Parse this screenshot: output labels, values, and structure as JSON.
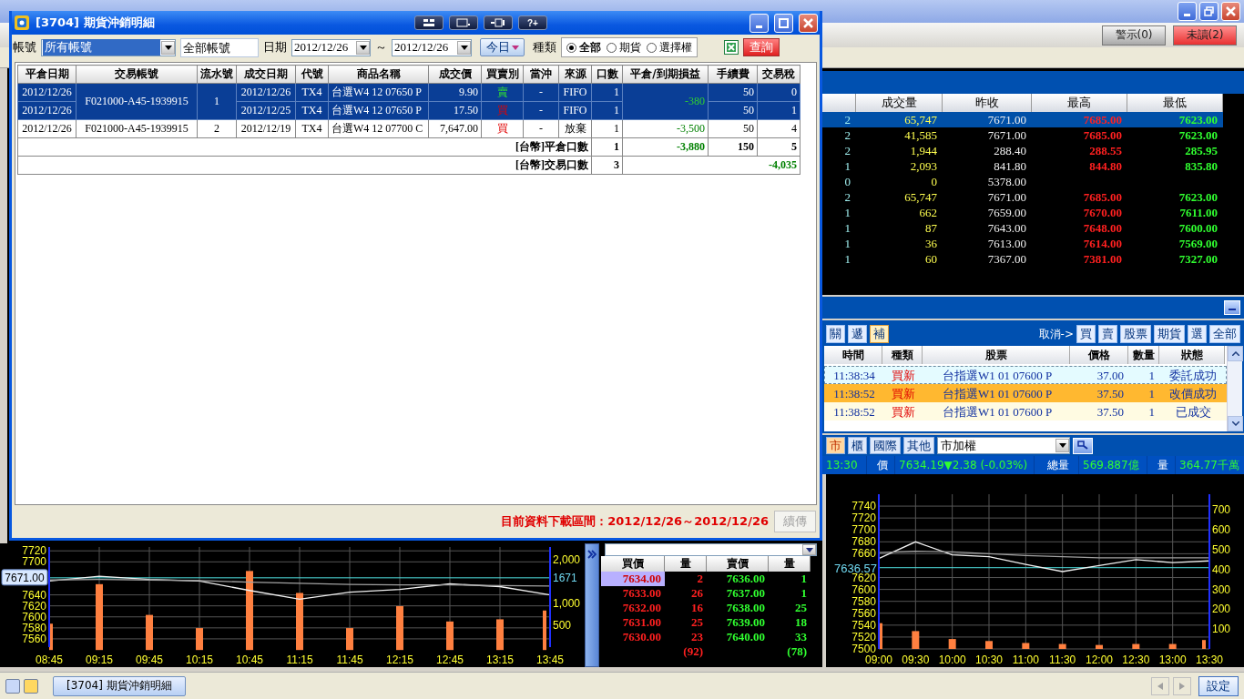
{
  "top_bar": {
    "alerts": [
      {
        "label": "警示(0)",
        "kind": "plain"
      },
      {
        "label": "未讀(2)",
        "kind": "alert"
      }
    ]
  },
  "quotes": {
    "columns": [
      "成交量",
      "昨收",
      "最高",
      "最低"
    ],
    "rows": [
      {
        "selected": true,
        "count": "2",
        "volume": "65,747",
        "prev_close": "7671.00",
        "high": "7685.00",
        "low": "7623.00"
      },
      {
        "selected": false,
        "count": "2",
        "volume": "41,585",
        "prev_close": "7671.00",
        "high": "7685.00",
        "low": "7623.00"
      },
      {
        "selected": false,
        "count": "2",
        "volume": "1,944",
        "prev_close": "288.40",
        "high": "288.55",
        "low": "285.95"
      },
      {
        "selected": false,
        "count": "1",
        "volume": "2,093",
        "prev_close": "841.80",
        "high": "844.80",
        "low": "835.80"
      },
      {
        "selected": false,
        "count": "0",
        "volume": "0",
        "prev_close": "5378.00"
      },
      {
        "selected": false,
        "count": "2",
        "volume": "65,747",
        "prev_close": "7671.00",
        "high": "7685.00",
        "low": "7623.00"
      },
      {
        "selected": false,
        "count": "1",
        "volume": "662",
        "prev_close": "7659.00",
        "high": "7670.00",
        "low": "7611.00"
      },
      {
        "selected": false,
        "count": "1",
        "volume": "87",
        "prev_close": "7643.00",
        "high": "7648.00",
        "low": "7600.00"
      },
      {
        "selected": false,
        "count": "1",
        "volume": "36",
        "prev_close": "7613.00",
        "high": "7614.00",
        "low": "7569.00"
      },
      {
        "selected": false,
        "count": "1",
        "volume": "60",
        "prev_close": "7367.00",
        "high": "7381.00",
        "low": "7327.00"
      }
    ]
  },
  "orders": {
    "actions": [
      {
        "label": "關",
        "selected": false
      },
      {
        "label": "遞",
        "selected": false
      },
      {
        "label": "補",
        "selected": true
      }
    ],
    "cancel_label": "取消->",
    "cancel_buttons": [
      "買",
      "賣",
      "股票",
      "期貨",
      "選",
      "全部"
    ],
    "columns": [
      "時間",
      "種類",
      "股票",
      "價格",
      "數量",
      "狀態"
    ],
    "rows": [
      {
        "selected": false,
        "focused": true,
        "time": "11:38:34",
        "type": "買新",
        "symbol": "台指選W1 01 07600 P",
        "price": "37.00",
        "qty": "1",
        "status": "委託成功"
      },
      {
        "selected": true,
        "focused": false,
        "time": "11:38:52",
        "type": "買新",
        "symbol": "台指選W1 01 07600 P",
        "price": "37.50",
        "qty": "1",
        "status": "改價成功"
      },
      {
        "selected": false,
        "focused": false,
        "time": "11:38:52",
        "type": "買新",
        "symbol": "台指選W1 01 07600 P",
        "price": "37.50",
        "qty": "1",
        "status": "已成交"
      }
    ]
  },
  "market": {
    "tabs": [
      {
        "label": "市",
        "selected": true
      },
      {
        "label": "櫃",
        "selected": false
      },
      {
        "label": "國際",
        "selected": false
      },
      {
        "label": "其他",
        "selected": false
      }
    ],
    "index_select": "市加權",
    "info": {
      "time": "13:30",
      "price_label": "價",
      "price": "7634.19▼2.38 (-0.03%)",
      "volume_label": "總量",
      "volume": "569.887億",
      "qty_label": "量",
      "qty": "364.77千萬"
    },
    "chart_data": {
      "type": "line",
      "categories": [
        "09:00",
        "09:30",
        "10:00",
        "10:30",
        "11:00",
        "11:30",
        "12:00",
        "12:30",
        "13:00",
        "13:30"
      ],
      "ylim": [
        7500,
        7760
      ],
      "yticks": [
        7500,
        7520,
        7540,
        7560,
        7580,
        7600,
        7620,
        7660,
        7680,
        7700,
        7720,
        7740
      ],
      "y2lim": [
        0,
        780
      ],
      "y2ticks": [
        100,
        200,
        300,
        400,
        500,
        600,
        700
      ],
      "series": [
        {
          "type": "line",
          "color": "#f0f0f0",
          "values": [
            7652,
            7680,
            7658,
            7655,
            7642,
            7630,
            7640,
            7650,
            7645,
            7648
          ]
        },
        {
          "type": "line",
          "color": "#a0a0a0",
          "values": [
            7662,
            7664,
            7663,
            7660,
            7657,
            7655,
            7653,
            7653,
            7653,
            7653
          ]
        },
        {
          "type": "bar",
          "axis": "y2",
          "color": "#ff8040",
          "values": [
            130,
            90,
            50,
            40,
            30,
            25,
            20,
            25,
            25,
            45
          ]
        }
      ],
      "grid": true,
      "ref_lines": [
        {
          "axis": "y",
          "value": 7636.57,
          "label": "7636.57"
        }
      ]
    }
  },
  "intraday": {
    "chart_data": {
      "type": "line",
      "categories": [
        "08:45",
        "09:15",
        "09:45",
        "10:15",
        "10:45",
        "11:15",
        "11:45",
        "12:15",
        "12:45",
        "13:15",
        "13:45"
      ],
      "ylim": [
        7545,
        7727
      ],
      "yticks": [
        7560,
        7580,
        7600,
        7620,
        7640,
        7700,
        7720
      ],
      "y2lim": [
        0,
        2280
      ],
      "y2ticks": [
        {
          "value": 500,
          "label": "500"
        },
        {
          "value": 1000,
          "label": "1,000"
        },
        {
          "value": 2000,
          "label": "2,000"
        }
      ],
      "series": [
        {
          "type": "line",
          "color": "#f0f0f0",
          "values": [
            7665,
            7674,
            7668,
            7665,
            7648,
            7632,
            7645,
            7650,
            7660,
            7655,
            7640
          ]
        },
        {
          "type": "line",
          "color": "#a0a0a0",
          "values": [
            7667,
            7668,
            7667,
            7666,
            7663,
            7661,
            7659,
            7658,
            7658,
            7657,
            7656
          ]
        },
        {
          "type": "bar",
          "axis": "y2",
          "color": "#ff8040",
          "values": [
            600,
            1500,
            800,
            500,
            1800,
            1300,
            500,
            1000,
            650,
            700,
            900
          ]
        }
      ],
      "grid": true,
      "ref_lines": [
        {
          "axis": "y",
          "value": 7671,
          "label": "7671.00"
        }
      ],
      "annotations": [
        "1671"
      ]
    }
  },
  "order_book": {
    "columns": [
      "買價",
      "量",
      "賣價",
      "量"
    ],
    "rows": [
      {
        "selected": true,
        "bid": "7634.00",
        "bid_qty": "2",
        "ask": "7636.00",
        "ask_qty": "1"
      },
      {
        "selected": false,
        "bid": "7633.00",
        "bid_qty": "26",
        "ask": "7637.00",
        "ask_qty": "1"
      },
      {
        "selected": false,
        "bid": "7632.00",
        "bid_qty": "16",
        "ask": "7638.00",
        "ask_qty": "25"
      },
      {
        "selected": false,
        "bid": "7631.00",
        "bid_qty": "25",
        "ask": "7639.00",
        "ask_qty": "18"
      },
      {
        "selected": false,
        "bid": "7630.00",
        "bid_qty": "23",
        "ask": "7640.00",
        "ask_qty": "33"
      }
    ],
    "totals": {
      "bid_qty": "(92)",
      "ask_qty": "(78)"
    }
  },
  "dialog": {
    "title": "[3704] 期貨沖銷明細",
    "help_button": "?+",
    "toolbar": {
      "account_label": "帳號",
      "account_select": "所有帳號",
      "account_field": "全部帳號",
      "date_label": "日期",
      "date_from": "2012/12/26",
      "separator": "～",
      "date_to": "2012/12/26",
      "today_button": "今日",
      "type_label": "種類",
      "types": [
        {
          "label": "全部",
          "selected": true
        },
        {
          "label": "期貨",
          "selected": false
        },
        {
          "label": "選擇權",
          "selected": false
        }
      ],
      "query_button": "查詢"
    },
    "table": {
      "columns": [
        "平倉日期",
        "交易帳號",
        "流水號",
        "成交日期",
        "代號",
        "商品名稱",
        "成交價",
        "買賣別",
        "當沖",
        "來源",
        "口數",
        "平倉/到期損益",
        "手續費",
        "交易稅"
      ],
      "groups": [
        {
          "selected": true,
          "account": "F021000-A45-1939915",
          "serial": "1",
          "pnl": "-380",
          "legs": [
            {
              "close_date": "2012/12/26",
              "trade_date": "2012/12/26",
              "code": "TX4",
              "product": "台選W4 12 07650 P",
              "price": "9.90",
              "side": "賣",
              "kind": "sell",
              "day_trade": "-",
              "source": "FIFO",
              "qty": "1",
              "fee": "50",
              "tax": "0"
            },
            {
              "close_date": "2012/12/26",
              "trade_date": "2012/12/25",
              "code": "TX4",
              "product": "台選W4 12 07650 P",
              "price": "17.50",
              "side": "買",
              "kind": "buy",
              "day_trade": "-",
              "source": "FIFO",
              "qty": "1",
              "fee": "50",
              "tax": "1"
            }
          ]
        },
        {
          "selected": false,
          "account": "F021000-A45-1939915",
          "serial": "2",
          "pnl": "-3,500",
          "legs": [
            {
              "close_date": "2012/12/26",
              "trade_date": "2012/12/19",
              "code": "TX4",
              "product": "台選W4 12 07700 C",
              "price": "7,647.00",
              "side": "買",
              "kind": "buy",
              "day_trade": "-",
              "source": "放棄",
              "qty": "1",
              "fee": "50",
              "tax": "4"
            }
          ]
        }
      ],
      "totals": [
        {
          "label": "[台幣]平倉口數",
          "qty": "1",
          "pnl": "-3,880",
          "fee": "150",
          "tax": "5"
        },
        {
          "label": "[台幣]交易口數",
          "qty": "3",
          "pnl": "-4,035"
        }
      ]
    },
    "footer": {
      "range": "目前資料下載區間：2012/12/26～2012/12/26",
      "resume_button": "續傳",
      "resume_disabled": true
    }
  },
  "taskbar": {
    "tasks": [
      {
        "label": "[3704] 期貨沖銷明細",
        "selected": false
      }
    ],
    "settings_button": "設定"
  }
}
